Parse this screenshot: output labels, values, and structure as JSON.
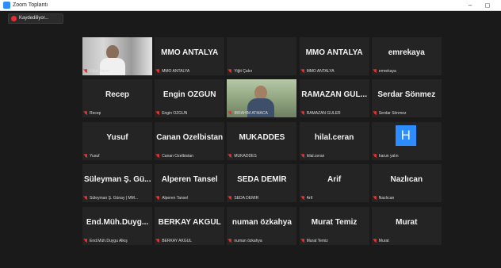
{
  "window": {
    "title": "Zoom Toplantı",
    "minimize": "–",
    "maximize": "◻"
  },
  "recording": {
    "label": "Kaydediliyor..."
  },
  "tiles": [
    {
      "type": "video",
      "label": "Uğur Sayın"
    },
    {
      "big": "MMO ANTALYA",
      "label": "MMO ANTALYA"
    },
    {
      "big": "",
      "label": "Yiğit Çakır"
    },
    {
      "big": "MMO ANTALYA",
      "label": "MMO ANTALYA"
    },
    {
      "big": "emrekaya",
      "label": "emrekaya"
    },
    {
      "big": "Recep",
      "label": "Recep"
    },
    {
      "big": "Engin ÖZGÜN",
      "label": "Engin ÖZGÜN"
    },
    {
      "type": "video",
      "active": true,
      "label": "İBRAHİM ATMACA"
    },
    {
      "big": "RAMAZAN GÜL...",
      "label": "RAMAZAN GÜLER"
    },
    {
      "big": "Serdar Sönmez",
      "label": "Serdar Sönmez"
    },
    {
      "big": "Yusuf",
      "label": "Yusuf"
    },
    {
      "big": "Canan Özelbistan",
      "label": "Canan Özelbistan"
    },
    {
      "big": "MUKADDES",
      "label": "MUKADDES"
    },
    {
      "big": "hilal.ceran",
      "label": "hilal.ceran"
    },
    {
      "avatar": "H",
      "label": "harun yalın"
    },
    {
      "big": "Süleyman Ş. Gü...",
      "label": "Süleyman Ş. Günay | MM..."
    },
    {
      "big": "Alperen Tansel",
      "label": "Alperen Tansel"
    },
    {
      "big": "SEDA DEMİR",
      "label": "SEDA DEMİR"
    },
    {
      "big": "Arif",
      "label": "Arif"
    },
    {
      "big": "Nazlıcan",
      "label": "Nazlıcan"
    },
    {
      "big": "End.Müh.Duyg...",
      "label": "End.Müh.Duygu Alkış"
    },
    {
      "big": "BERKAY AKGÜL",
      "label": "BERKAY AKGÜL"
    },
    {
      "big": "numan özkahya",
      "label": "numan özkahya"
    },
    {
      "big": "Murat Temiz",
      "label": "Murat Temiz"
    },
    {
      "big": "Murat",
      "label": "Murat"
    }
  ],
  "colors": {
    "tile_bg": "#242424",
    "active_outline": "#b8e04a",
    "muted_mic": "#e03232",
    "avatar_bg": "#2d8cff"
  }
}
